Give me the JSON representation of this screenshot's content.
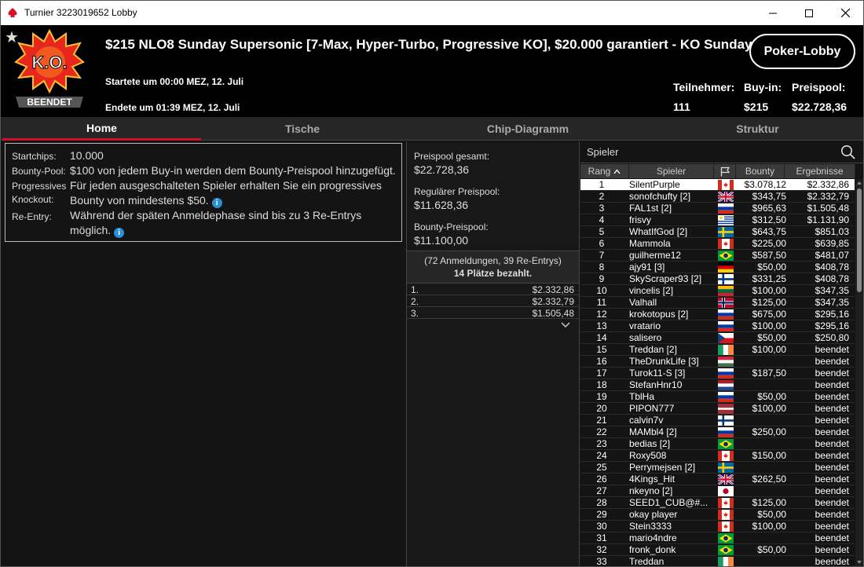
{
  "window": {
    "title": "Turnier 3223019652 Lobby"
  },
  "header": {
    "logo_text": "K.O.",
    "badge": "BEENDET",
    "title": "$215 NLO8 Sunday Supersonic [7-Max, Hyper-Turbo, Progressive KO], $20.000 garantiert - KO Sunday!",
    "started": "Startete um 00:00 MEZ, 12. Juli",
    "ended": "Endete um 01:39 MEZ, 12. Juli",
    "poker_lobby_button": "Poker-Lobby",
    "stats": [
      {
        "label": "Teilnehmer:",
        "value": "111"
      },
      {
        "label": "Buy-in:",
        "value": "$215"
      },
      {
        "label": "Preispool:",
        "value": "$22.728,36"
      }
    ]
  },
  "tabs": [
    {
      "label": "Home",
      "active": true
    },
    {
      "label": "Tische",
      "active": false
    },
    {
      "label": "Chip-Diagramm",
      "active": false
    },
    {
      "label": "Struktur",
      "active": false
    }
  ],
  "info": [
    {
      "label": "Startchips:",
      "value": "10.000"
    },
    {
      "label": "Bounty-Pool:",
      "value": "$100 von jedem Buy-in werden dem Bounty-Preispool hinzugefügt."
    },
    {
      "label": "Progressives Knockout:",
      "value": "Für jeden ausgeschalteten Spieler erhalten Sie ein progressives Bounty von mindestens $50."
    },
    {
      "label": "Re-Entry:",
      "value": "Während der späten Anmeldephase sind bis zu 3 Re-Entrys möglich."
    }
  ],
  "prize": {
    "sections": [
      {
        "label": "Preispool gesamt:",
        "value": "$22.728,36"
      },
      {
        "label": "Regulärer Preispool:",
        "value": "$11.628,36"
      },
      {
        "label": "Bounty-Preispool:",
        "value": "$11.100,00"
      }
    ],
    "registrations": "(72 Anmeldungen, 39 Re-Entrys)",
    "paid": "14 Plätze bezahlt.",
    "places": [
      {
        "rank": "1.",
        "value": "$2.332,86"
      },
      {
        "rank": "2.",
        "value": "$2.332,79"
      },
      {
        "rank": "3.",
        "value": "$1.505,48"
      }
    ]
  },
  "players": {
    "search_placeholder": "Spieler",
    "columns": {
      "rank": "Rang",
      "player": "Spieler",
      "bounty": "Bounty",
      "results": "Ergebnisse"
    },
    "rows": [
      {
        "rank": "1",
        "name": "SilentPurple",
        "flag": "ca",
        "bounty": "$3.078,12",
        "result": "$2.332,86",
        "selected": true
      },
      {
        "rank": "2",
        "name": "sonofchufty [2]",
        "flag": "gb",
        "bounty": "$343,75",
        "result": "$2.332,79"
      },
      {
        "rank": "3",
        "name": "FAL1st [2]",
        "flag": "ru",
        "bounty": "$965,63",
        "result": "$1.505,48"
      },
      {
        "rank": "4",
        "name": "frisvy",
        "flag": "uy",
        "bounty": "$312,50",
        "result": "$1.131,90"
      },
      {
        "rank": "5",
        "name": "WhatIfGod [2]",
        "flag": "se",
        "bounty": "$643,75",
        "result": "$851,03"
      },
      {
        "rank": "6",
        "name": "Mammola",
        "flag": "ca",
        "bounty": "$225,00",
        "result": "$639,85"
      },
      {
        "rank": "7",
        "name": "guilherme12",
        "flag": "br",
        "bounty": "$587,50",
        "result": "$481,07"
      },
      {
        "rank": "8",
        "name": "ajy91 [3]",
        "flag": "de",
        "bounty": "$50,00",
        "result": "$408,78"
      },
      {
        "rank": "9",
        "name": "SkyScraper93 [2]",
        "flag": "fi",
        "bounty": "$331,25",
        "result": "$408,78"
      },
      {
        "rank": "10",
        "name": "vincelis [2]",
        "flag": "lt",
        "bounty": "$100,00",
        "result": "$347,35"
      },
      {
        "rank": "11",
        "name": "Valhall",
        "flag": "no",
        "bounty": "$125,00",
        "result": "$347,35"
      },
      {
        "rank": "12",
        "name": "krokotopus [2]",
        "flag": "ru",
        "bounty": "$675,00",
        "result": "$295,16"
      },
      {
        "rank": "13",
        "name": "vratario",
        "flag": "ru",
        "bounty": "$100,00",
        "result": "$295,16"
      },
      {
        "rank": "14",
        "name": "salisero",
        "flag": "cz",
        "bounty": "$50,00",
        "result": "$250,80"
      },
      {
        "rank": "15",
        "name": "Treddan [2]",
        "flag": "ie",
        "bounty": "$100,00",
        "result": "beendet"
      },
      {
        "rank": "16",
        "name": "TheDrunkLife [3]",
        "flag": "hu",
        "bounty": "",
        "result": "beendet"
      },
      {
        "rank": "17",
        "name": "Turok11-S [3]",
        "flag": "ru",
        "bounty": "$187,50",
        "result": "beendet"
      },
      {
        "rank": "18",
        "name": "StefanHnr10",
        "flag": "nl",
        "bounty": "",
        "result": "beendet"
      },
      {
        "rank": "19",
        "name": "TblHa",
        "flag": "ru",
        "bounty": "$50,00",
        "result": "beendet"
      },
      {
        "rank": "20",
        "name": "PIPON777",
        "flag": "lv",
        "bounty": "$100,00",
        "result": "beendet"
      },
      {
        "rank": "21",
        "name": "calvin7v",
        "flag": "fi",
        "bounty": "",
        "result": "beendet"
      },
      {
        "rank": "22",
        "name": "MAMbl4 [2]",
        "flag": "ru",
        "bounty": "$250,00",
        "result": "beendet"
      },
      {
        "rank": "23",
        "name": "bedias [2]",
        "flag": "br",
        "bounty": "",
        "result": "beendet"
      },
      {
        "rank": "24",
        "name": "Roxy508",
        "flag": "ca",
        "bounty": "$150,00",
        "result": "beendet"
      },
      {
        "rank": "25",
        "name": "Perrymejsen [2]",
        "flag": "se",
        "bounty": "",
        "result": "beendet"
      },
      {
        "rank": "26",
        "name": "4Kings_Hit",
        "flag": "gb",
        "bounty": "$262,50",
        "result": "beendet"
      },
      {
        "rank": "27",
        "name": "nkeyno [2]",
        "flag": "jp",
        "bounty": "",
        "result": "beendet"
      },
      {
        "rank": "28",
        "name": "SEED1_CUB@#...",
        "flag": "ca",
        "bounty": "$125,00",
        "result": "beendet"
      },
      {
        "rank": "29",
        "name": "okay player",
        "flag": "ca",
        "bounty": "$50,00",
        "result": "beendet"
      },
      {
        "rank": "30",
        "name": "Stein3333",
        "flag": "ca",
        "bounty": "$100,00",
        "result": "beendet"
      },
      {
        "rank": "31",
        "name": "mario4ndre",
        "flag": "br",
        "bounty": "",
        "result": "beendet"
      },
      {
        "rank": "32",
        "name": "fronk_donk",
        "flag": "br",
        "bounty": "$50,00",
        "result": "beendet"
      },
      {
        "rank": "33",
        "name": "Treddan",
        "flag": "ie",
        "bounty": "",
        "result": "beendet"
      }
    ]
  }
}
